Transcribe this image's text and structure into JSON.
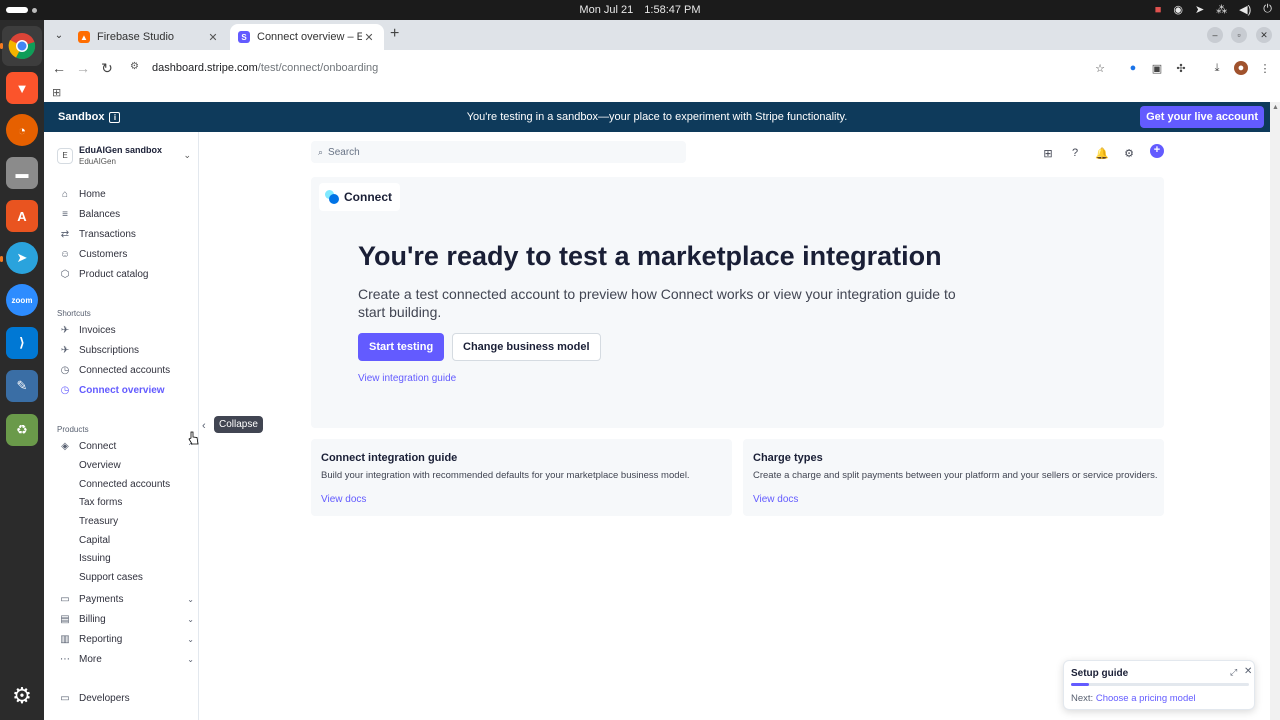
{
  "os": {
    "clock": {
      "date": "Mon Jul 21",
      "time": "1:58:47 PM"
    }
  },
  "dock": {
    "apps": [
      {
        "name": "chrome-icon",
        "color": "#34a853"
      },
      {
        "name": "brave-icon",
        "color": "#fb542b"
      },
      {
        "name": "firefox-icon",
        "color": "#ff7139"
      },
      {
        "name": "files-icon",
        "color": "#8b8b8b"
      },
      {
        "name": "app-center-icon",
        "color": "#e95420"
      },
      {
        "name": "telegram-icon",
        "color": "#2aa3dd"
      },
      {
        "name": "zoom-icon",
        "color": "#2d8cff"
      },
      {
        "name": "vscode-icon",
        "color": "#0078d4"
      },
      {
        "name": "text-editor-icon",
        "color": "#3a6ea5"
      },
      {
        "name": "trash-icon",
        "color": "#6a9a4a"
      },
      {
        "name": "ubuntu-apps-icon",
        "color": "#ffffff"
      }
    ],
    "zoom_label": "zoom"
  },
  "browser": {
    "tabs": [
      {
        "title": "Firebase Studio",
        "active": false
      },
      {
        "title": "Connect overview – EduAIGen",
        "active": true
      }
    ],
    "url_host": "dashboard.stripe.com",
    "url_path": "/test/connect/onboarding"
  },
  "sandbox_banner": {
    "label": "Sandbox",
    "message": "You're testing in a sandbox—your place to experiment with Stripe functionality.",
    "cta": "Get your live account"
  },
  "account": {
    "initial": "E",
    "name": "EduAIGen sandbox",
    "sub": "EduAIGen"
  },
  "sidebar": {
    "main": [
      {
        "label": "Home",
        "icon": "home-icon"
      },
      {
        "label": "Balances",
        "icon": "balances-icon"
      },
      {
        "label": "Transactions",
        "icon": "transactions-icon"
      },
      {
        "label": "Customers",
        "icon": "customers-icon"
      },
      {
        "label": "Product catalog",
        "icon": "product-catalog-icon"
      }
    ],
    "shortcuts_label": "Shortcuts",
    "shortcuts": [
      {
        "label": "Invoices",
        "icon": "pin-icon"
      },
      {
        "label": "Subscriptions",
        "icon": "pin-icon"
      },
      {
        "label": "Connected accounts",
        "icon": "clock-icon"
      },
      {
        "label": "Connect overview",
        "icon": "clock-icon",
        "active": true
      }
    ],
    "products_label": "Products",
    "connect": {
      "label": "Connect",
      "subitems": [
        "Overview",
        "Connected accounts",
        "Tax forms",
        "Treasury",
        "Capital",
        "Issuing",
        "Support cases"
      ]
    },
    "products": [
      {
        "label": "Payments",
        "icon": "payments-icon"
      },
      {
        "label": "Billing",
        "icon": "billing-icon"
      },
      {
        "label": "Reporting",
        "icon": "reporting-icon"
      },
      {
        "label": "More",
        "icon": "more-icon"
      }
    ],
    "developers": "Developers",
    "collapse_tooltip": "Collapse"
  },
  "search": {
    "placeholder": "Search"
  },
  "hero": {
    "chip": "Connect",
    "title": "You're ready to test a marketplace integration",
    "description": "Create a test connected account to preview how Connect works or view your integration guide to start building.",
    "primary_button": "Start testing",
    "secondary_button": "Change business model",
    "link": "View integration guide"
  },
  "cards": [
    {
      "title": "Connect integration guide",
      "description": "Build your integration with recommended defaults for your marketplace business model.",
      "link": "View docs"
    },
    {
      "title": "Charge types",
      "description": "Create a charge and split payments between your platform and your sellers or service providers.",
      "link": "View docs"
    }
  ],
  "setup_guide": {
    "title": "Setup guide",
    "progress": 0.1,
    "next_label": "Next:",
    "next_link": "Choose a pricing model"
  },
  "colors": {
    "accent": "#635bff",
    "banner": "#0e3a5b"
  }
}
